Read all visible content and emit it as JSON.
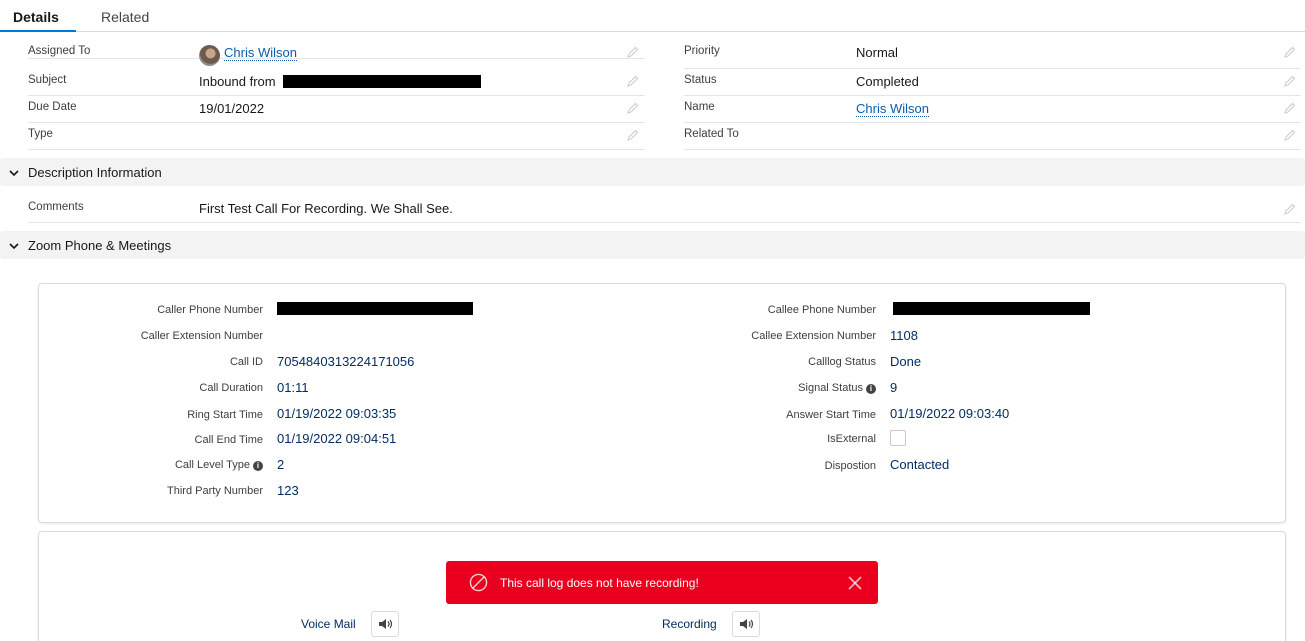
{
  "tabs": {
    "details": "Details",
    "related": "Related"
  },
  "details": {
    "assigned_to": {
      "label": "Assigned To",
      "value": "Chris Wilson"
    },
    "subject": {
      "label": "Subject",
      "value": "Inbound from"
    },
    "due_date": {
      "label": "Due Date",
      "value": "19/01/2022"
    },
    "type": {
      "label": "Type",
      "value": ""
    },
    "priority": {
      "label": "Priority",
      "value": "Normal"
    },
    "status": {
      "label": "Status",
      "value": "Completed"
    },
    "name": {
      "label": "Name",
      "value": "Chris Wilson"
    },
    "related_to": {
      "label": "Related To",
      "value": ""
    }
  },
  "description_section": {
    "title": "Description Information",
    "comments": {
      "label": "Comments",
      "value": "First Test Call For Recording. We Shall See."
    }
  },
  "zoom_section": {
    "title": "Zoom Phone & Meetings",
    "left": [
      {
        "label": "Caller Phone Number",
        "value": ""
      },
      {
        "label": "Caller Extension Number",
        "value": ""
      },
      {
        "label": "Call ID",
        "value": "7054840313224171056"
      },
      {
        "label": "Call Duration",
        "value": "01:11"
      },
      {
        "label": "Ring Start Time",
        "value": "01/19/2022 09:03:35"
      },
      {
        "label": "Call End Time",
        "value": "01/19/2022 09:04:51"
      },
      {
        "label": "Call Level Type",
        "value": "2"
      },
      {
        "label": "Third Party Number",
        "value": "123"
      }
    ],
    "right": [
      {
        "label": "Callee Phone Number",
        "value": ""
      },
      {
        "label": "Callee Extension Number",
        "value": "1108"
      },
      {
        "label": "Calllog Status",
        "value": "Done"
      },
      {
        "label": "Signal Status",
        "value": "9"
      },
      {
        "label": "Answer Start Time",
        "value": "01/19/2022 09:03:40"
      },
      {
        "label": "IsExternal",
        "value": ""
      },
      {
        "label": "Dispostion",
        "value": "Contacted"
      }
    ],
    "is_external_checked": false
  },
  "toast": {
    "message": "This call log does not have recording!",
    "color": "#ea001e"
  },
  "media": {
    "voice_mail": "Voice Mail",
    "recording": "Recording"
  },
  "colors": {
    "accent": "#0176d3",
    "link": "#0b5cab",
    "value_text": "#032d60"
  }
}
